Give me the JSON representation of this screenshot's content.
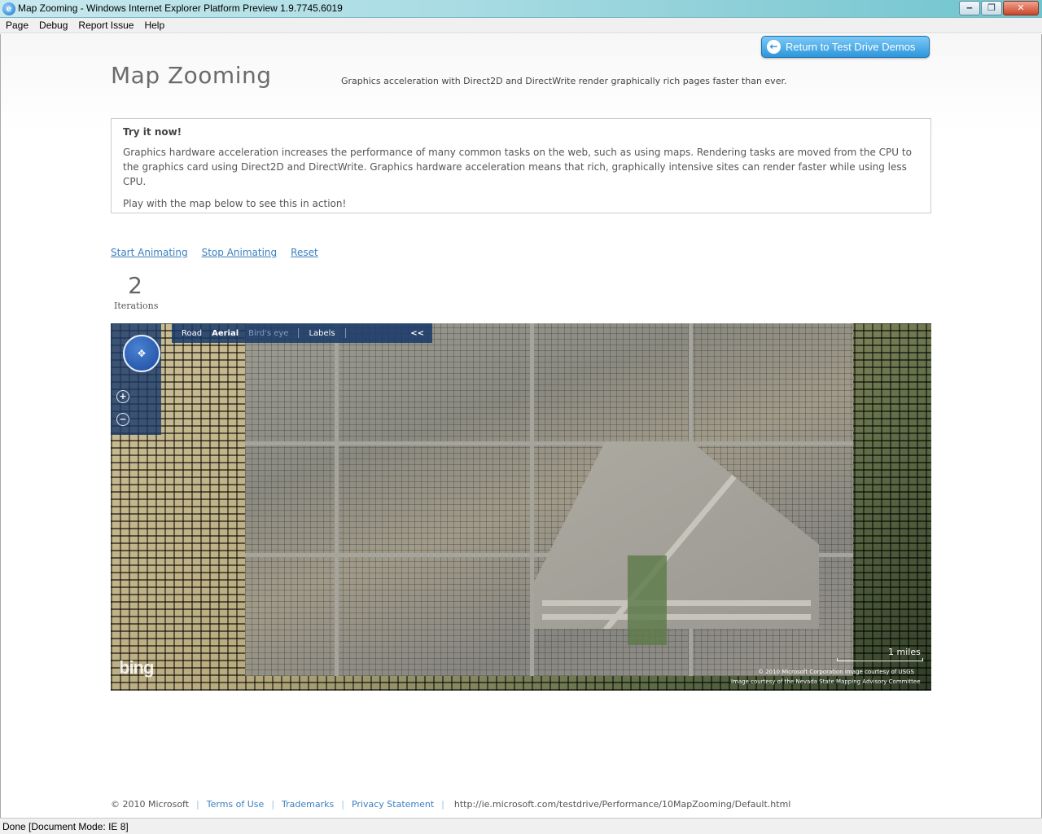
{
  "window": {
    "title": "Map Zooming - Windows Internet Explorer Platform Preview 1.9.7745.6019",
    "min_label": "‒",
    "max_label": "❐",
    "close_label": "✕"
  },
  "menu": {
    "items": [
      "Page",
      "Debug",
      "Report Issue",
      "Help"
    ]
  },
  "page": {
    "return_label": "Return to Test Drive Demos",
    "title": "Map Zooming",
    "subtitle": "Graphics acceleration with Direct2D and DirectWrite render graphically rich pages faster than ever.",
    "info": {
      "heading": "Try it now!",
      "p1": "Graphics hardware acceleration increases the performance of many common tasks on the web, such as using maps. Rendering tasks are moved from the CPU to the graphics card using Direct2D and DirectWrite. Graphics hardware acceleration means that rich, graphically intensive sites can render faster while using less CPU.",
      "p2": "Play with the map below to see this in action!"
    },
    "links": {
      "start": "Start Animating",
      "stop": "Stop Animating",
      "reset": "Reset"
    },
    "counter": {
      "value": "2",
      "label": "Iterations"
    }
  },
  "map": {
    "nav": {
      "road": "Road",
      "aerial": "Aerial",
      "birds_eye": "Bird's eye",
      "labels": "Labels",
      "collapse": "<<"
    },
    "zoom_in": "+",
    "zoom_out": "−",
    "logo": "bing",
    "scale": "1 miles",
    "copyright_1": "© 2010 Microsoft Corporation    Image courtesy of USGS",
    "copyright_2": "Image courtesy of the Nevada State Mapping Advisory Committee"
  },
  "footer": {
    "copyright": "© 2010 Microsoft",
    "terms": "Terms of Use",
    "trademarks": "Trademarks",
    "privacy": "Privacy Statement",
    "url": "http://ie.microsoft.com/testdrive/Performance/10MapZooming/Default.html"
  },
  "status": {
    "text": "Done [Document Mode: IE 8]"
  }
}
